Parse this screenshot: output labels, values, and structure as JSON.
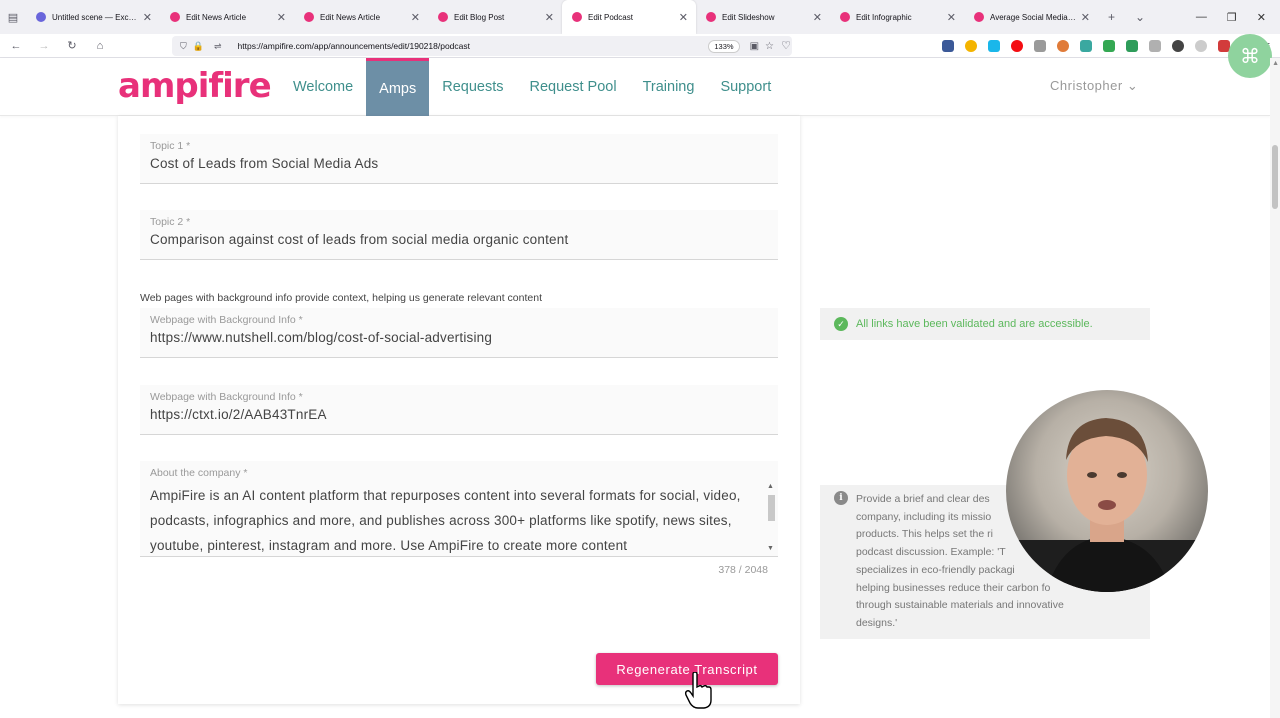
{
  "browser": {
    "tabs": [
      {
        "title": "Untitled scene — Excalidraw",
        "active": false,
        "fav_color": "#6965db"
      },
      {
        "title": "Edit News Article",
        "active": false,
        "fav_color": "#e8317a"
      },
      {
        "title": "Edit News Article",
        "active": false,
        "fav_color": "#e8317a"
      },
      {
        "title": "Edit Blog Post",
        "active": false,
        "fav_color": "#e8317a"
      },
      {
        "title": "Edit Podcast",
        "active": true,
        "fav_color": "#e8317a"
      },
      {
        "title": "Edit Slideshow",
        "active": false,
        "fav_color": "#e8317a"
      },
      {
        "title": "Edit Infographic",
        "active": false,
        "fav_color": "#e8317a"
      },
      {
        "title": "Average Social Media Cost",
        "active": false,
        "fav_color": "#e8317a"
      }
    ],
    "url": "https://ampifire.com/app/announcements/edit/190218/podcast",
    "zoom": "133%"
  },
  "site": {
    "logo": "ampifire",
    "brand_color": "#e8317a",
    "nav": [
      {
        "label": "Welcome",
        "active": false
      },
      {
        "label": "Amps",
        "active": true
      },
      {
        "label": "Requests",
        "active": false
      },
      {
        "label": "Request Pool",
        "active": false
      },
      {
        "label": "Training",
        "active": false
      },
      {
        "label": "Support",
        "active": false
      }
    ],
    "user": "Christopher"
  },
  "form": {
    "topic1": {
      "label": "Topic 1 *",
      "value": "Cost of Leads from Social Media Ads"
    },
    "topic2": {
      "label": "Topic 2 *",
      "value": "Comparison against cost of leads from social media organic content"
    },
    "helper": "Web pages with background info provide context, helping us generate relevant content",
    "webpage1": {
      "label": "Webpage with Background Info *",
      "value": "https://www.nutshell.com/blog/cost-of-social-advertising"
    },
    "webpage2": {
      "label": "Webpage with Background Info *",
      "value": "https://ctxt.io/2/AAB43TnrEA"
    },
    "about": {
      "label": "About the company *",
      "value": "AmpiFire is an AI content platform that repurposes content into several formats for social, video, podcasts, infographics and more, and publishes across 300+ platforms like spotify, news sites, youtube, pinterest, instagram and more. Use AmpiFire to create more content",
      "count": "378 / 2048"
    },
    "regenerate_label": "Regenerate Transcript"
  },
  "side": {
    "links_validated": "All links have been validated and are accessible.",
    "tip_lines": [
      "Provide a brief and clear des",
      "company, including its missio",
      "products. This helps set the ri",
      "podcast discussion. Example: 'T",
      "specializes in eco-friendly packagi",
      "helping businesses reduce their carbon fo",
      "through sustainable materials and innovative",
      "designs.'"
    ]
  }
}
